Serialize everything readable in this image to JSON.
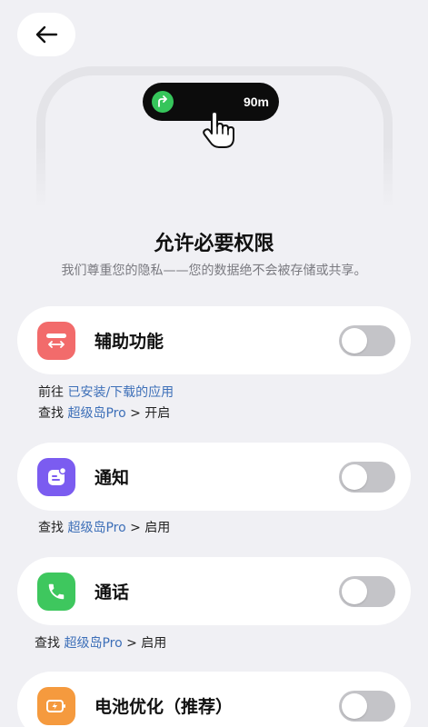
{
  "illustration": {
    "island_distance": "90m"
  },
  "header": {
    "title": "允许必要权限",
    "subtitle": "我们尊重您的隐私——您的数据绝不会被存储或共享。"
  },
  "permissions": [
    {
      "label": "辅助功能",
      "icon": "accessibility-icon",
      "icon_color": "#f26b6b",
      "enabled": false,
      "hint_lines": [
        {
          "prefix": "前往 ",
          "link": "已安装/下载的应用",
          "suffix": ""
        },
        {
          "prefix": "查找 ",
          "link": "超级岛Pro",
          "suffix": " > 开启"
        }
      ]
    },
    {
      "label": "通知",
      "icon": "notification-icon",
      "icon_color": "#7b5cf0",
      "enabled": false,
      "hint_lines": [
        {
          "prefix": "查找 ",
          "link": "超级岛Pro",
          "suffix": " > 启用"
        }
      ]
    },
    {
      "label": "通话",
      "icon": "phone-icon",
      "icon_color": "#3ec75e",
      "enabled": false,
      "hint_lines": [
        {
          "prefix": "查找 ",
          "link": "超级岛Pro",
          "suffix": " > 启用"
        }
      ]
    },
    {
      "label": "电池优化（推荐）",
      "icon": "battery-icon",
      "icon_color": "#f59a3e",
      "enabled": false
    }
  ],
  "colors": {
    "background": "#f0f0f4",
    "link": "#3d6fb8",
    "toggle_off": "#c4c4c8",
    "island_icon": "#36c55b"
  }
}
